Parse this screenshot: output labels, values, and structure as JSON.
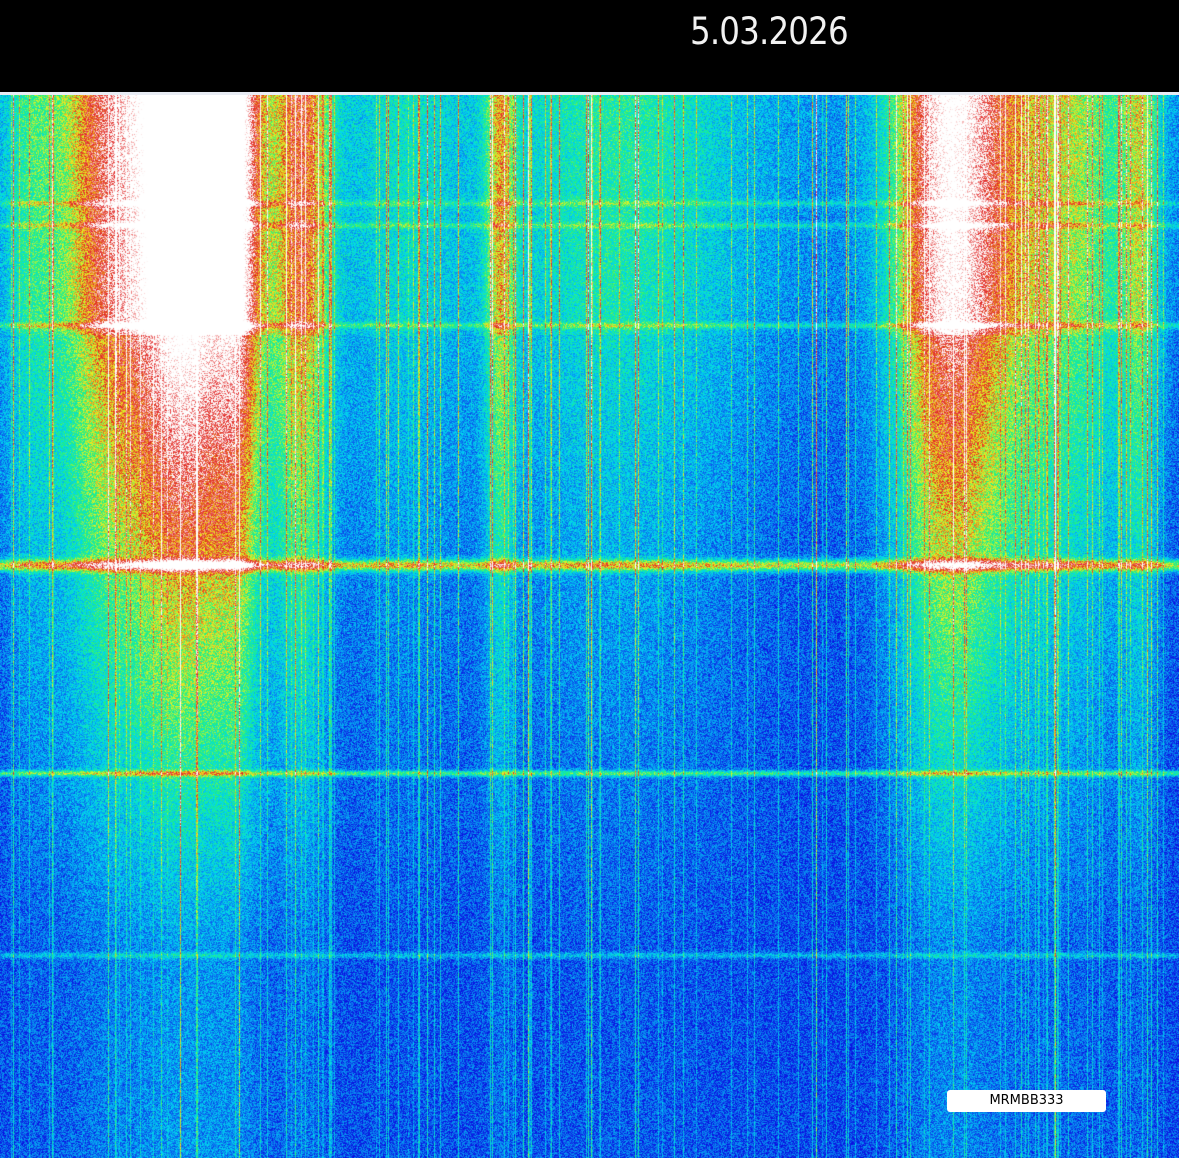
{
  "header": {
    "date": "5.03.2026"
  },
  "watermark": {
    "label": "MRMBB333"
  },
  "chart_data": {
    "type": "heatmap",
    "title": "",
    "xlabel": "",
    "ylabel": "",
    "colormap": [
      "#0a10e0",
      "#0a7cf0",
      "#00d8f0",
      "#20f080",
      "#f0f020",
      "#e02020",
      "#ffffff"
    ],
    "grid": false,
    "legend": "none"
  }
}
